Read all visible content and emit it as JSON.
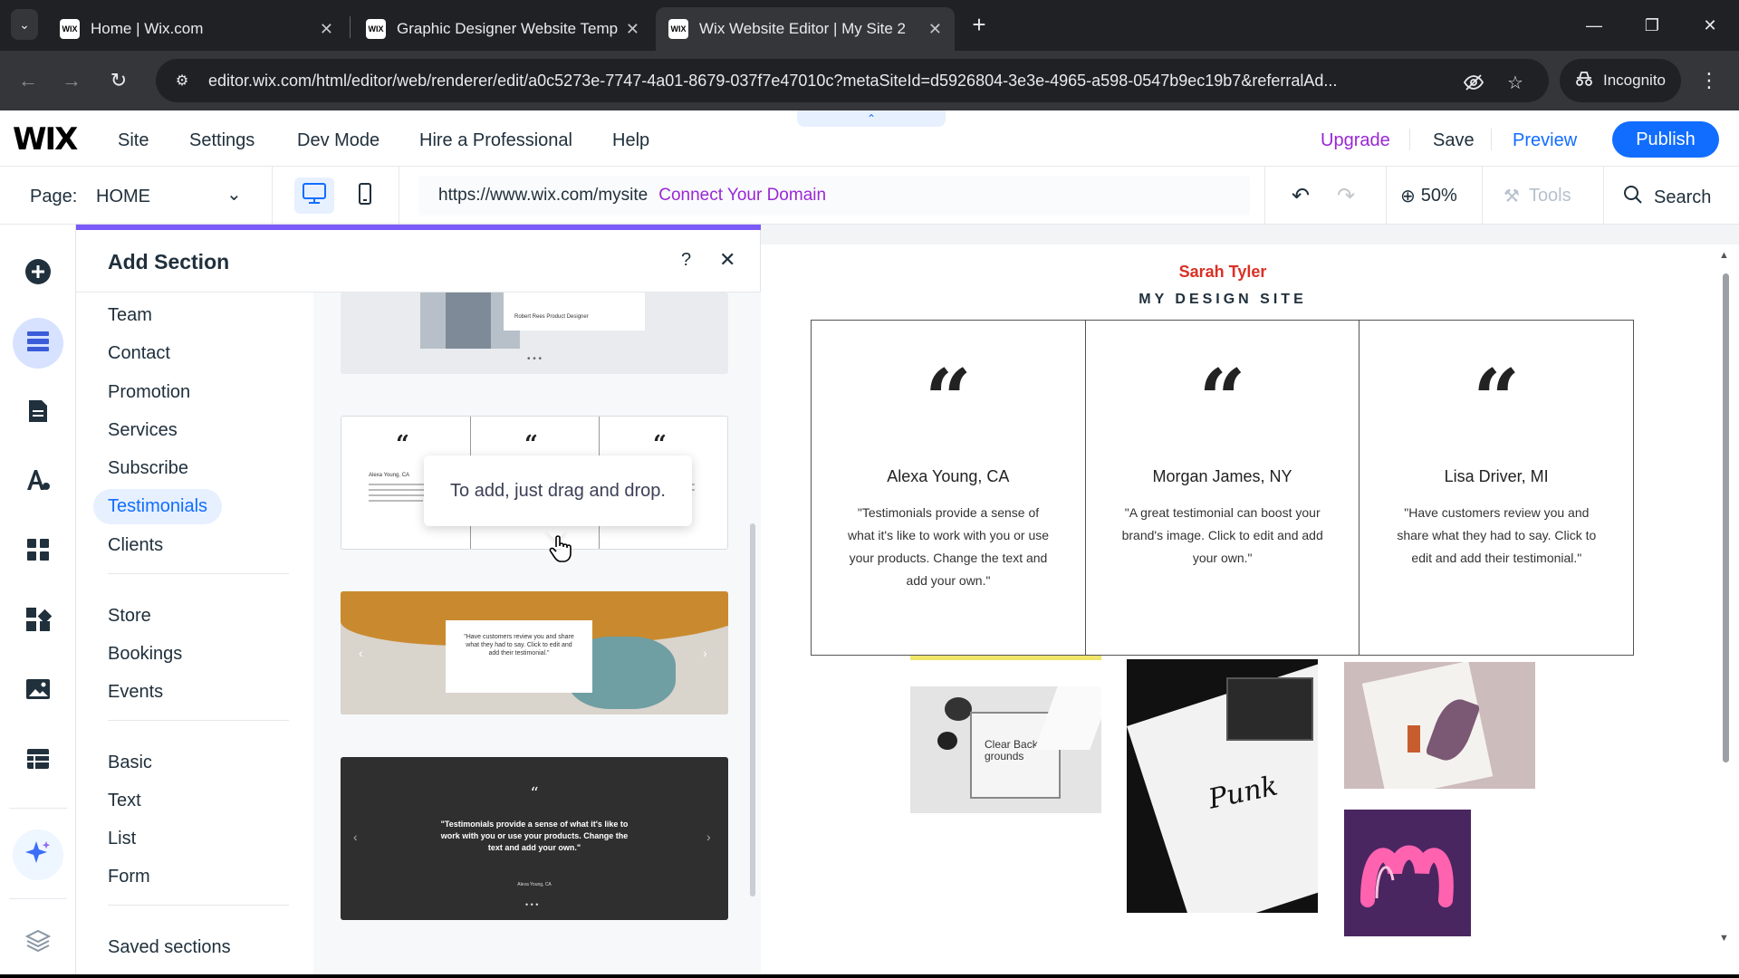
{
  "browser": {
    "tabs": [
      {
        "title": "Home | Wix.com",
        "favicon": "WIX"
      },
      {
        "title": "Graphic Designer Website Temp",
        "favicon": "WIX"
      },
      {
        "title": "Wix Website Editor | My Site 2",
        "favicon": "WIX"
      }
    ],
    "url": "editor.wix.com/html/editor/web/renderer/edit/a0c5273e-7747-4a01-8679-037f7e47010c?metaSiteId=d5926804-3e3e-4965-a598-0547b9ec19b7&referralAd...",
    "incognito_label": "Incognito"
  },
  "editor": {
    "logo": "WIX",
    "menu": [
      "Site",
      "Settings",
      "Dev Mode",
      "Hire a Professional",
      "Help"
    ],
    "upgrade": "Upgrade",
    "save": "Save",
    "preview": "Preview",
    "publish": "Publish",
    "page_label": "Page:",
    "page_value": "HOME",
    "site_url": "https://www.wix.com/mysite",
    "connect_domain": "Connect Your Domain",
    "zoom": "50%",
    "tools": "Tools",
    "search": "Search"
  },
  "panel": {
    "title": "Add Section",
    "help": "?",
    "categories_group1": [
      "Team",
      "Contact",
      "Promotion",
      "Services",
      "Subscribe",
      "Testimonials",
      "Clients"
    ],
    "categories_group2": [
      "Store",
      "Bookings",
      "Events"
    ],
    "categories_group3": [
      "Basic",
      "Text",
      "List",
      "Form"
    ],
    "saved_sections": "Saved sections",
    "active_category": "Testimonials",
    "tooltip": "To add, just drag and drop.",
    "thumb1_caption": "Robert Rees  Product Designer",
    "thumb2_name": "Alexa Young, CA",
    "thumb3_text": "\"Have customers review you and share what they had to say. Click to edit and add their testimonial.\"",
    "thumb4_text": "\"Testimonials provide a sense of what it's like to work with you or use your products. Change the text and add your own.\"",
    "thumb4_name": "Alexa Young, CA"
  },
  "site": {
    "name": "Sarah Tyler",
    "tagline": "MY DESIGN SITE",
    "testimonials": [
      {
        "name": "Alexa Young, CA",
        "text": "\"Testimonials provide a sense of what it's like to work with you or use your products. Change the text and add your own.\""
      },
      {
        "name": "Morgan James, NY",
        "text": "\"A great testimonial can boost your brand's image. Click to edit and add your own.\""
      },
      {
        "name": "Lisa Driver, MI",
        "text": "\"Have customers review you and share what they had to say. Click to edit and add their testimonial.\""
      }
    ],
    "photo1_text": "Clear Back-grounds",
    "photo2_text": "Punk"
  },
  "colors": {
    "accent": "#116dff",
    "upgrade": "#9a27d5",
    "panel_topline": "#7a5af8",
    "site_name": "#d93025",
    "browser_dark": "#202124",
    "browser_tab": "#35363a"
  }
}
